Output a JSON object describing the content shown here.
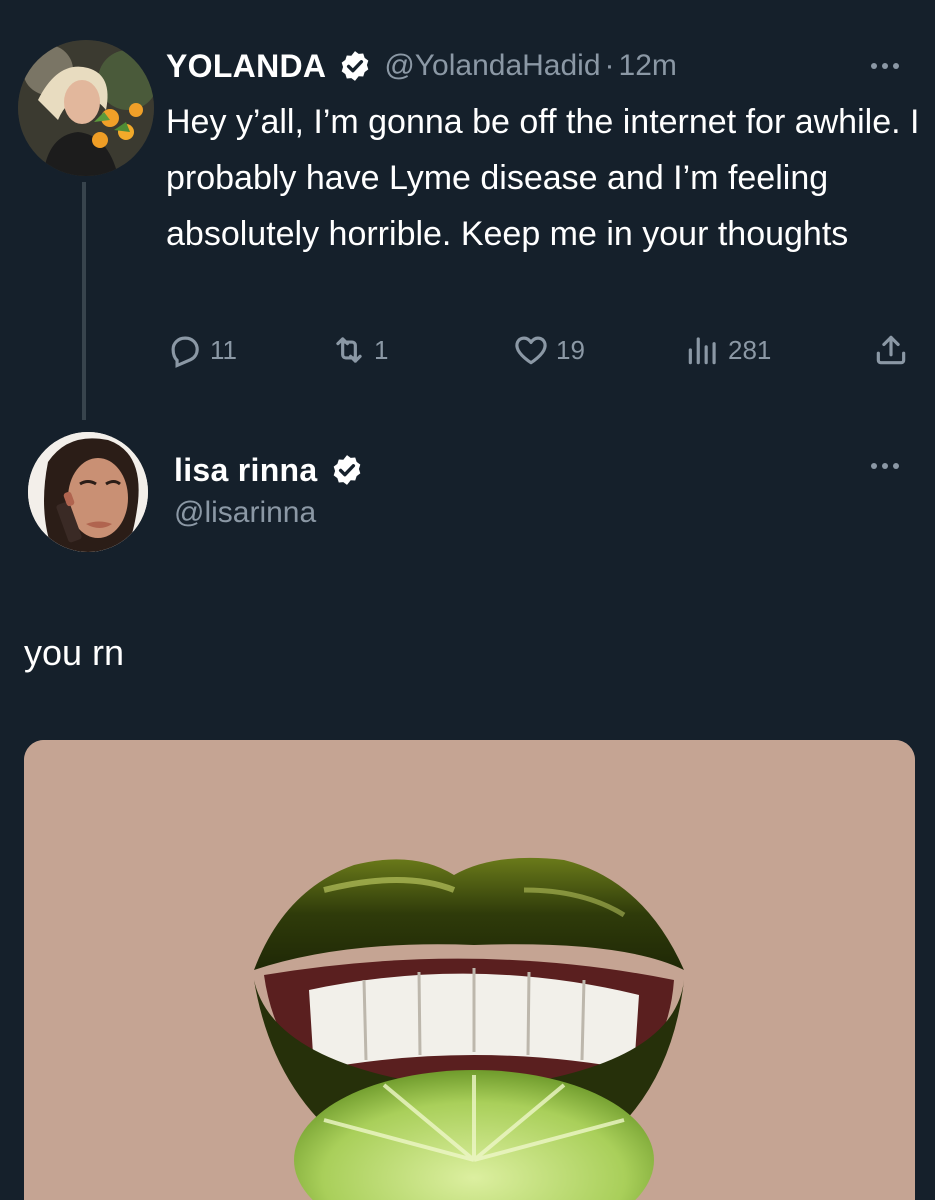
{
  "tweet1": {
    "name": "YOLANDA",
    "handle": "@YolandaHadid",
    "separator": "·",
    "time": "12m",
    "body": "Hey y’all, I’m gonna be off the internet for awhile. I probably have Lyme disease and I’m feeling absolutely horrible. Keep me in your thoughts",
    "stats": {
      "replies": "11",
      "retweets": "1",
      "likes": "19",
      "views": "281"
    }
  },
  "tweet2": {
    "name": "lisa rinna",
    "handle": "@lisarinna",
    "body": "you rn"
  },
  "icons": {
    "verified": "verified-badge-icon",
    "more": "more-options-icon",
    "reply": "reply-icon",
    "retweet": "retweet-icon",
    "like": "heart-icon",
    "views": "views-chart-icon",
    "share": "share-icon"
  },
  "colors": {
    "background": "#15202b",
    "secondary_text": "#8b98a5",
    "thread_line": "#38444d",
    "media_background": "#c5a493"
  }
}
